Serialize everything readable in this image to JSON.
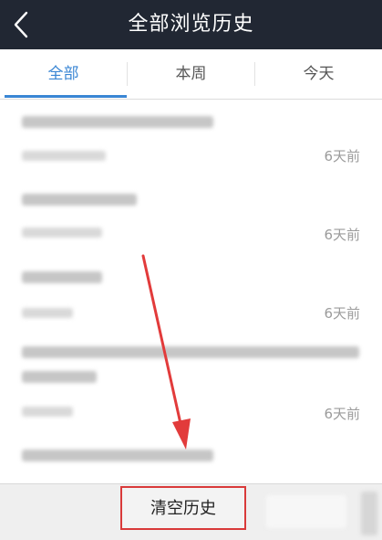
{
  "header": {
    "title": "全部浏览历史",
    "back_icon": "chevron-left-icon"
  },
  "tabs": [
    {
      "label": "全部",
      "active": true
    },
    {
      "label": "本周",
      "active": false
    },
    {
      "label": "今天",
      "active": false
    }
  ],
  "history": [
    {
      "time": "6天前"
    },
    {
      "time": "6天前"
    },
    {
      "time": "6天前"
    },
    {
      "time": "6天前"
    },
    {
      "time": ""
    }
  ],
  "footer": {
    "clear_label": "清空历史"
  },
  "colors": {
    "nav_bg": "#212733",
    "accent": "#3a86d4",
    "highlight": "#d93a3a"
  }
}
